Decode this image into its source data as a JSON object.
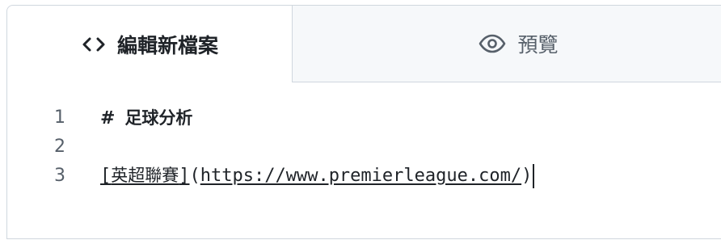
{
  "tabs": {
    "edit": {
      "label": "編輯新檔案",
      "icon": "code-icon",
      "active": true
    },
    "preview": {
      "label": "預覽",
      "icon": "eye-icon",
      "active": false
    }
  },
  "editor": {
    "lines": [
      {
        "number": "1",
        "heading_mark": "#",
        "heading_text": "足球分析"
      },
      {
        "number": "2",
        "text": ""
      },
      {
        "number": "3",
        "link_open": "[",
        "link_text": "英超聯賽",
        "link_close": "]",
        "paren_open": "(",
        "url": "https://www.premierleague.com/",
        "paren_close": ")"
      }
    ]
  },
  "colors": {
    "text": "#1f2328",
    "muted": "#57606a",
    "border": "#d0d7de",
    "inactive_tab_bg": "#f6f8fa"
  }
}
